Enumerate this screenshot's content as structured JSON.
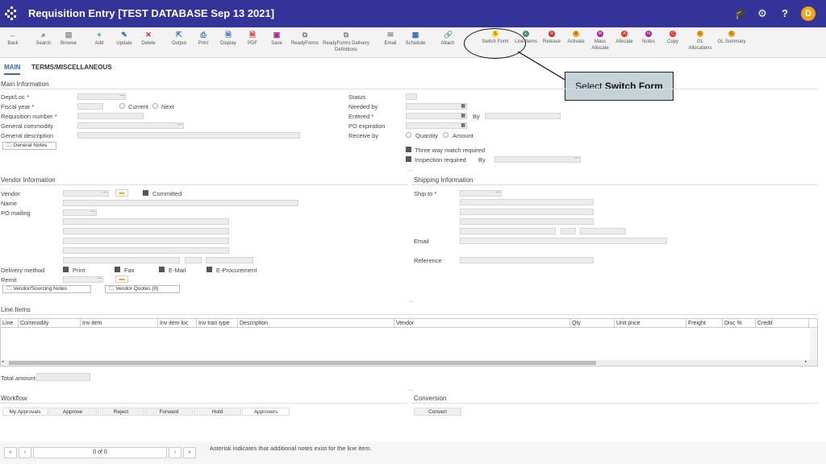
{
  "header": {
    "title": "Requisition Entry [TEST DATABASE Sep 13 2021]",
    "avatar_letter": "D",
    "accent": "#34339a"
  },
  "toolbar": {
    "items": [
      {
        "label": "Back",
        "icon": "back-arrow-icon"
      },
      {
        "label": "Search",
        "icon": "search-icon"
      },
      {
        "label": "Browse",
        "icon": "browse-icon"
      },
      {
        "label": "Add",
        "icon": "plus-icon"
      },
      {
        "label": "Update",
        "icon": "update-icon"
      },
      {
        "label": "Delete",
        "icon": "delete-x-icon"
      },
      {
        "label": "Output",
        "icon": "output-icon"
      },
      {
        "label": "Print",
        "icon": "print-icon"
      },
      {
        "label": "Display",
        "icon": "display-icon"
      },
      {
        "label": "PDF",
        "icon": "pdf-icon"
      },
      {
        "label": "Save",
        "icon": "save-icon"
      },
      {
        "label": "ReadyForms",
        "icon": "readyforms-icon"
      },
      {
        "label": "ReadyForms Delivery",
        "label2": "Definitions",
        "icon": "readyforms-delivery-icon"
      },
      {
        "label": "Email",
        "icon": "email-icon"
      },
      {
        "label": "Schedule",
        "icon": "schedule-icon"
      },
      {
        "label": "Attach",
        "icon": "attach-icon"
      },
      {
        "label": "Switch Form",
        "badge": "S"
      },
      {
        "label": "Line Items",
        "badge": "L"
      },
      {
        "label": "Release",
        "badge": "R"
      },
      {
        "label": "Activate",
        "badge": "A"
      },
      {
        "label": "Mass",
        "label2": "Allocate",
        "badge": "M"
      },
      {
        "label": "Allocate",
        "badge": "A"
      },
      {
        "label": "Notes",
        "badge": "N"
      },
      {
        "label": "Copy",
        "badge": "C"
      },
      {
        "label": "GL",
        "label2": "Allocations",
        "badge": "G"
      },
      {
        "label": "GL Summary",
        "badge": "G"
      }
    ]
  },
  "callout": {
    "prefix": "Select ",
    "bold": "Switch Form"
  },
  "tabs": [
    "MAIN",
    "TERMS/MISCELLANEOUS"
  ],
  "main_info": {
    "heading": "Main Information",
    "dept_loc": "Dept/Loc *",
    "fiscal_year": "Fiscal year *",
    "current": "Current",
    "next": "Next",
    "req_number": "Requisition number *",
    "gen_commodity": "General commodity",
    "gen_description": "General description",
    "general_notes": "General Notes",
    "status": "Status",
    "needed_by": "Needed by",
    "entered": "Entered *",
    "by": "By",
    "po_expiration": "PO expiration",
    "receive_by": "Receive by",
    "quantity": "Quantity",
    "amount": "Amount",
    "three_way": "Three way match required",
    "inspection": "Inspection required",
    "by2": "By"
  },
  "vendor": {
    "heading": "Vendor Information",
    "vendor": "Vendor",
    "committed": "Committed",
    "name": "Name",
    "po_mailing": "PO mailing",
    "delivery_method": "Delivery method",
    "print": "Print",
    "fax": "Fax",
    "email": "E-Mail",
    "eproc": "E-Procurement",
    "remit": "Remit",
    "sourcing_notes": "Vendor/Sourcing Notes",
    "quotes": "Vendor Quotes (0)"
  },
  "shipping": {
    "heading": "Shipping Information",
    "ship_to": "Ship to *",
    "email": "Email",
    "reference": "Reference"
  },
  "line_items": {
    "heading": "Line Items",
    "columns": [
      "Line",
      "Commodity",
      "Inv item",
      "Inv item loc",
      "Inv tran type",
      "Description",
      "Vendor",
      "Qty",
      "Unit price",
      "Freight",
      "Disc %",
      "Credit"
    ]
  },
  "total_amount": "Total amount",
  "workflow": {
    "heading": "Workflow",
    "buttons": [
      "My Approvals",
      "Approve",
      "Reject",
      "Forward",
      "Hold",
      "Approvers"
    ]
  },
  "conversion": {
    "heading": "Conversion",
    "button": "Convert"
  },
  "pager": {
    "text": "0 of 0",
    "note": "Asterisk indicates that additional notes exist for the line item."
  }
}
